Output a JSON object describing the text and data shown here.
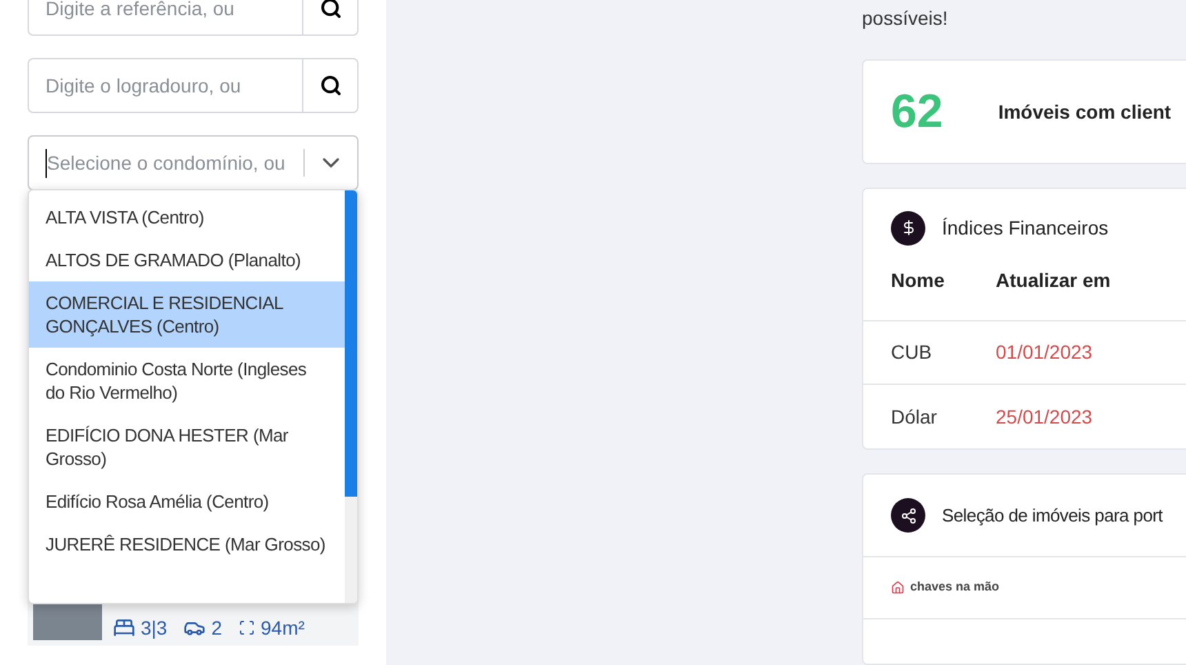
{
  "search_fields": [
    {
      "placeholder": "Digite a referência, ou"
    },
    {
      "placeholder": "Digite o logradouro, ou"
    }
  ],
  "condo_select": {
    "placeholder": "Selecione o condomínio, ou",
    "expanded": true,
    "options": [
      {
        "label": "ALTA VISTA (Centro)",
        "selected": false
      },
      {
        "label": "ALTOS DE GRAMADO (Planalto)",
        "selected": false
      },
      {
        "label": "COMERCIAL E RESIDENCIAL GONÇALVES (Centro)",
        "selected": true
      },
      {
        "label": "Condominio Costa Norte (Ingleses do Rio Vermelho)",
        "selected": false
      },
      {
        "label": "EDIFÍCIO DONA HESTER (Mar Grosso)",
        "selected": false
      },
      {
        "label": "Edifício Rosa Amélia (Centro)",
        "selected": false
      },
      {
        "label": "JURERÊ RESIDENCE (Mar Grosso)",
        "selected": false
      }
    ]
  },
  "listing": {
    "bedrooms": "3|3",
    "parking": "2",
    "area": "94m²"
  },
  "intro_text": "possíveis!",
  "stat_card": {
    "value": "62",
    "label": "Imóveis com client"
  },
  "financial": {
    "title": "Índices Financeiros",
    "columns": [
      "Nome",
      "Atualizar em"
    ],
    "rows": [
      {
        "name": "CUB",
        "date": "01/01/2023"
      },
      {
        "name": "Dólar",
        "date": "25/01/2023"
      }
    ]
  },
  "portals": {
    "title": "Seleção de imóveis para port",
    "items": [
      "chaves na mão"
    ]
  }
}
